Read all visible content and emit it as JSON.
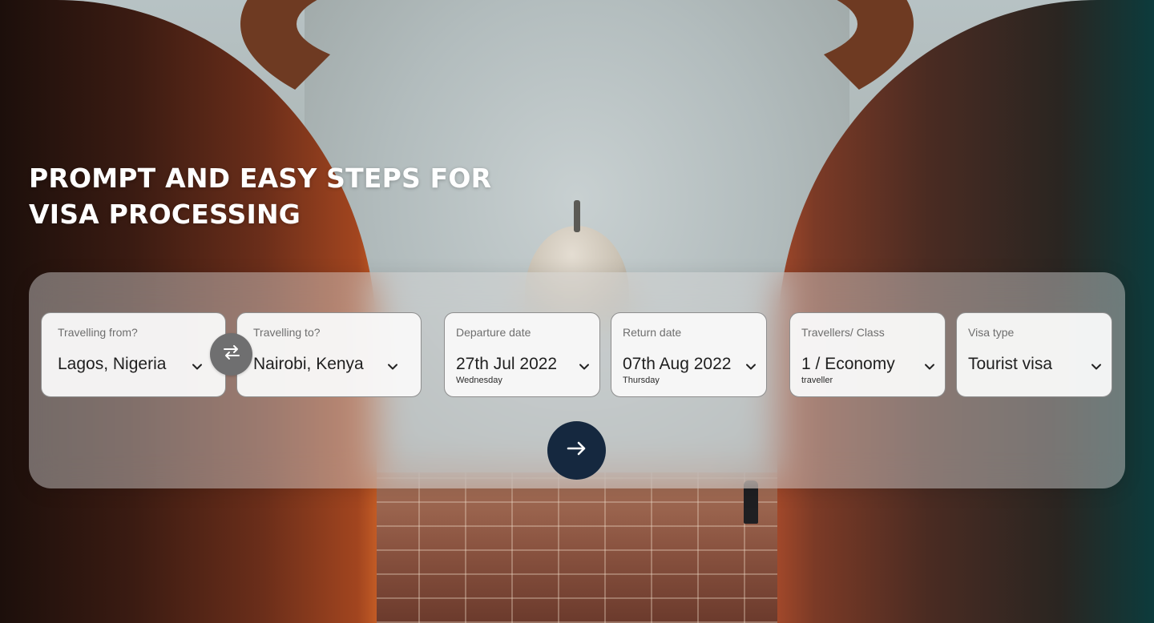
{
  "hero": {
    "headline_line1": "PROMPT AND EASY STEPS FOR",
    "headline_line2": "VISA PROCESSING"
  },
  "search": {
    "from": {
      "label": "Travelling from?",
      "value": "Lagos, Nigeria"
    },
    "to": {
      "label": "Travelling to?",
      "value": "Nairobi, Kenya"
    },
    "departure": {
      "label": "Departure date",
      "value": "27th Jul 2022",
      "sub": "Wednesday"
    },
    "return": {
      "label": "Return date",
      "value": "07th Aug 2022",
      "sub": "Thursday"
    },
    "travellers": {
      "label": "Travellers/ Class",
      "value": "1 / Economy",
      "sub": "traveller"
    },
    "visa": {
      "label": "Visa type",
      "value": "Tourist visa"
    }
  },
  "icons": {
    "swap": "swap-arrows-icon",
    "submit": "arrow-right-icon",
    "dropdown": "chevron-down-icon"
  },
  "colors": {
    "submit_button": "#15283f",
    "swap_button": "#6f6f70",
    "headline": "#ffffff"
  }
}
